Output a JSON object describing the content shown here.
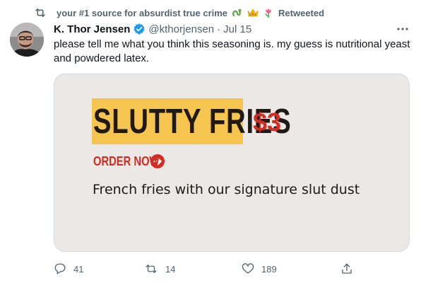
{
  "retweet": {
    "user_name": "your #1 source for absurdist true crime",
    "status_label": "Retweeted",
    "emojis": [
      "snake-emoji",
      "crown-emoji",
      "tulip-emoji"
    ]
  },
  "tweet": {
    "display_name": "K. Thor Jensen",
    "verified": true,
    "handle": "@kthorjensen",
    "separator": "·",
    "date": "Jul 15",
    "text": "please tell me what you think this seasoning is. my guess is nutritional yeast and powdered latex.",
    "media": {
      "headline": "SLUTTY FRIES",
      "price": "$3",
      "cta_label": "ORDER NOW",
      "description": "French fries with our signature slut dust"
    }
  },
  "actions": {
    "reply_count": "41",
    "retweet_count": "14",
    "like_count": "189"
  },
  "colors": {
    "text": "#0f1419",
    "muted": "#536471",
    "verified_blue": "#1d9bf0",
    "media_bg": "#ece8e5",
    "highlight_yellow": "#f6c550",
    "accent_red": "#d42b22"
  },
  "icons": {
    "retweet": "retweet-icon",
    "verified": "verified-badge-icon",
    "more": "more-options-icon",
    "reply": "reply-icon",
    "like": "heart-icon",
    "share": "share-icon",
    "order_arrow": "arrow-circle-icon"
  }
}
